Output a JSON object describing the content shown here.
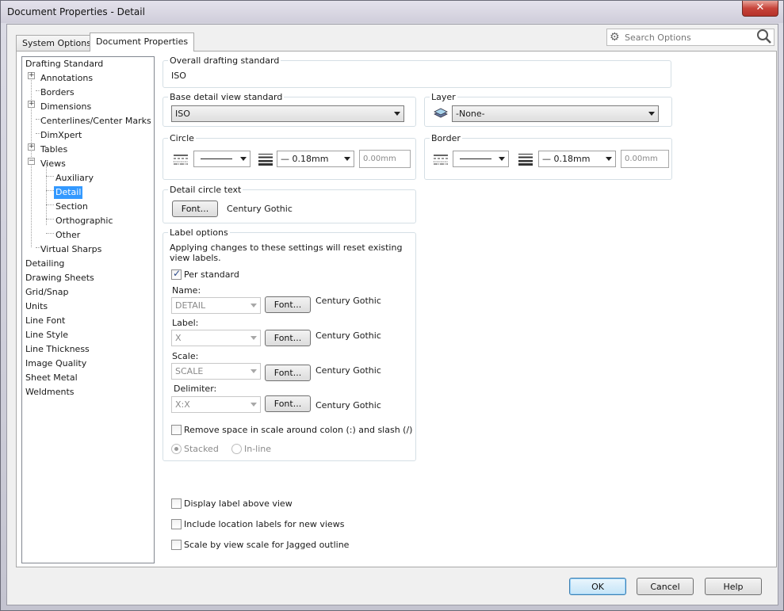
{
  "window": {
    "title": "Document Properties - Detail",
    "close_glyph": "✕"
  },
  "tabs": [
    {
      "label": "System Options"
    },
    {
      "label": "Document Properties"
    }
  ],
  "search": {
    "placeholder": "Search Options"
  },
  "tree": {
    "items": [
      {
        "label": "Drafting Standard"
      },
      {
        "label": "Annotations"
      },
      {
        "label": "Borders"
      },
      {
        "label": "Dimensions"
      },
      {
        "label": "Centerlines/Center Marks"
      },
      {
        "label": "DimXpert"
      },
      {
        "label": "Tables"
      },
      {
        "label": "Views"
      },
      {
        "label": "Auxiliary"
      },
      {
        "label": "Detail"
      },
      {
        "label": "Section"
      },
      {
        "label": "Orthographic"
      },
      {
        "label": "Other"
      },
      {
        "label": "Virtual Sharps"
      },
      {
        "label": "Detailing"
      },
      {
        "label": "Drawing Sheets"
      },
      {
        "label": "Grid/Snap"
      },
      {
        "label": "Units"
      },
      {
        "label": "Line Font"
      },
      {
        "label": "Line Style"
      },
      {
        "label": "Line Thickness"
      },
      {
        "label": "Image Quality"
      },
      {
        "label": "Sheet Metal"
      },
      {
        "label": "Weldments"
      }
    ],
    "expand_plus": "+",
    "expand_minus": "−"
  },
  "overall": {
    "label": "Overall drafting standard",
    "value": "ISO"
  },
  "base_detail": {
    "label": "Base detail view standard",
    "value": "ISO"
  },
  "layer": {
    "label": "Layer",
    "value": "-None-"
  },
  "circle": {
    "label": "Circle",
    "thickness": "— 0.18mm",
    "custom": "0.00mm"
  },
  "border": {
    "label": "Border",
    "thickness": "— 0.18mm",
    "custom": "0.00mm"
  },
  "detail_circle_text": {
    "label": "Detail circle text",
    "font_button": "Font...",
    "font_name": "Century Gothic"
  },
  "label_options": {
    "label": "Label options",
    "note": "Applying changes to these settings will reset existing view labels.",
    "per_standard": "Per standard",
    "rows": [
      {
        "caption": "Name:",
        "value": "DETAIL",
        "font_button": "Font...",
        "font_name": "Century Gothic"
      },
      {
        "caption": "Label:",
        "value": "X",
        "font_button": "Font...",
        "font_name": "Century Gothic"
      },
      {
        "caption": "Scale:",
        "value": "SCALE",
        "font_button": "Font...",
        "font_name": "Century Gothic"
      },
      {
        "caption": "Delimiter:",
        "value": "X:X",
        "font_button": "Font...",
        "font_name": "Century Gothic"
      }
    ],
    "remove_space": "Remove space in scale around colon (:) and slash (/)",
    "stacked": "Stacked",
    "inline": "In-line"
  },
  "options": {
    "display_label": "Display label above view",
    "include_location": "Include location labels for new views",
    "scale_jagged": "Scale by view scale for Jagged outline"
  },
  "footer": {
    "ok": "OK",
    "cancel": "Cancel",
    "help": "Help"
  }
}
